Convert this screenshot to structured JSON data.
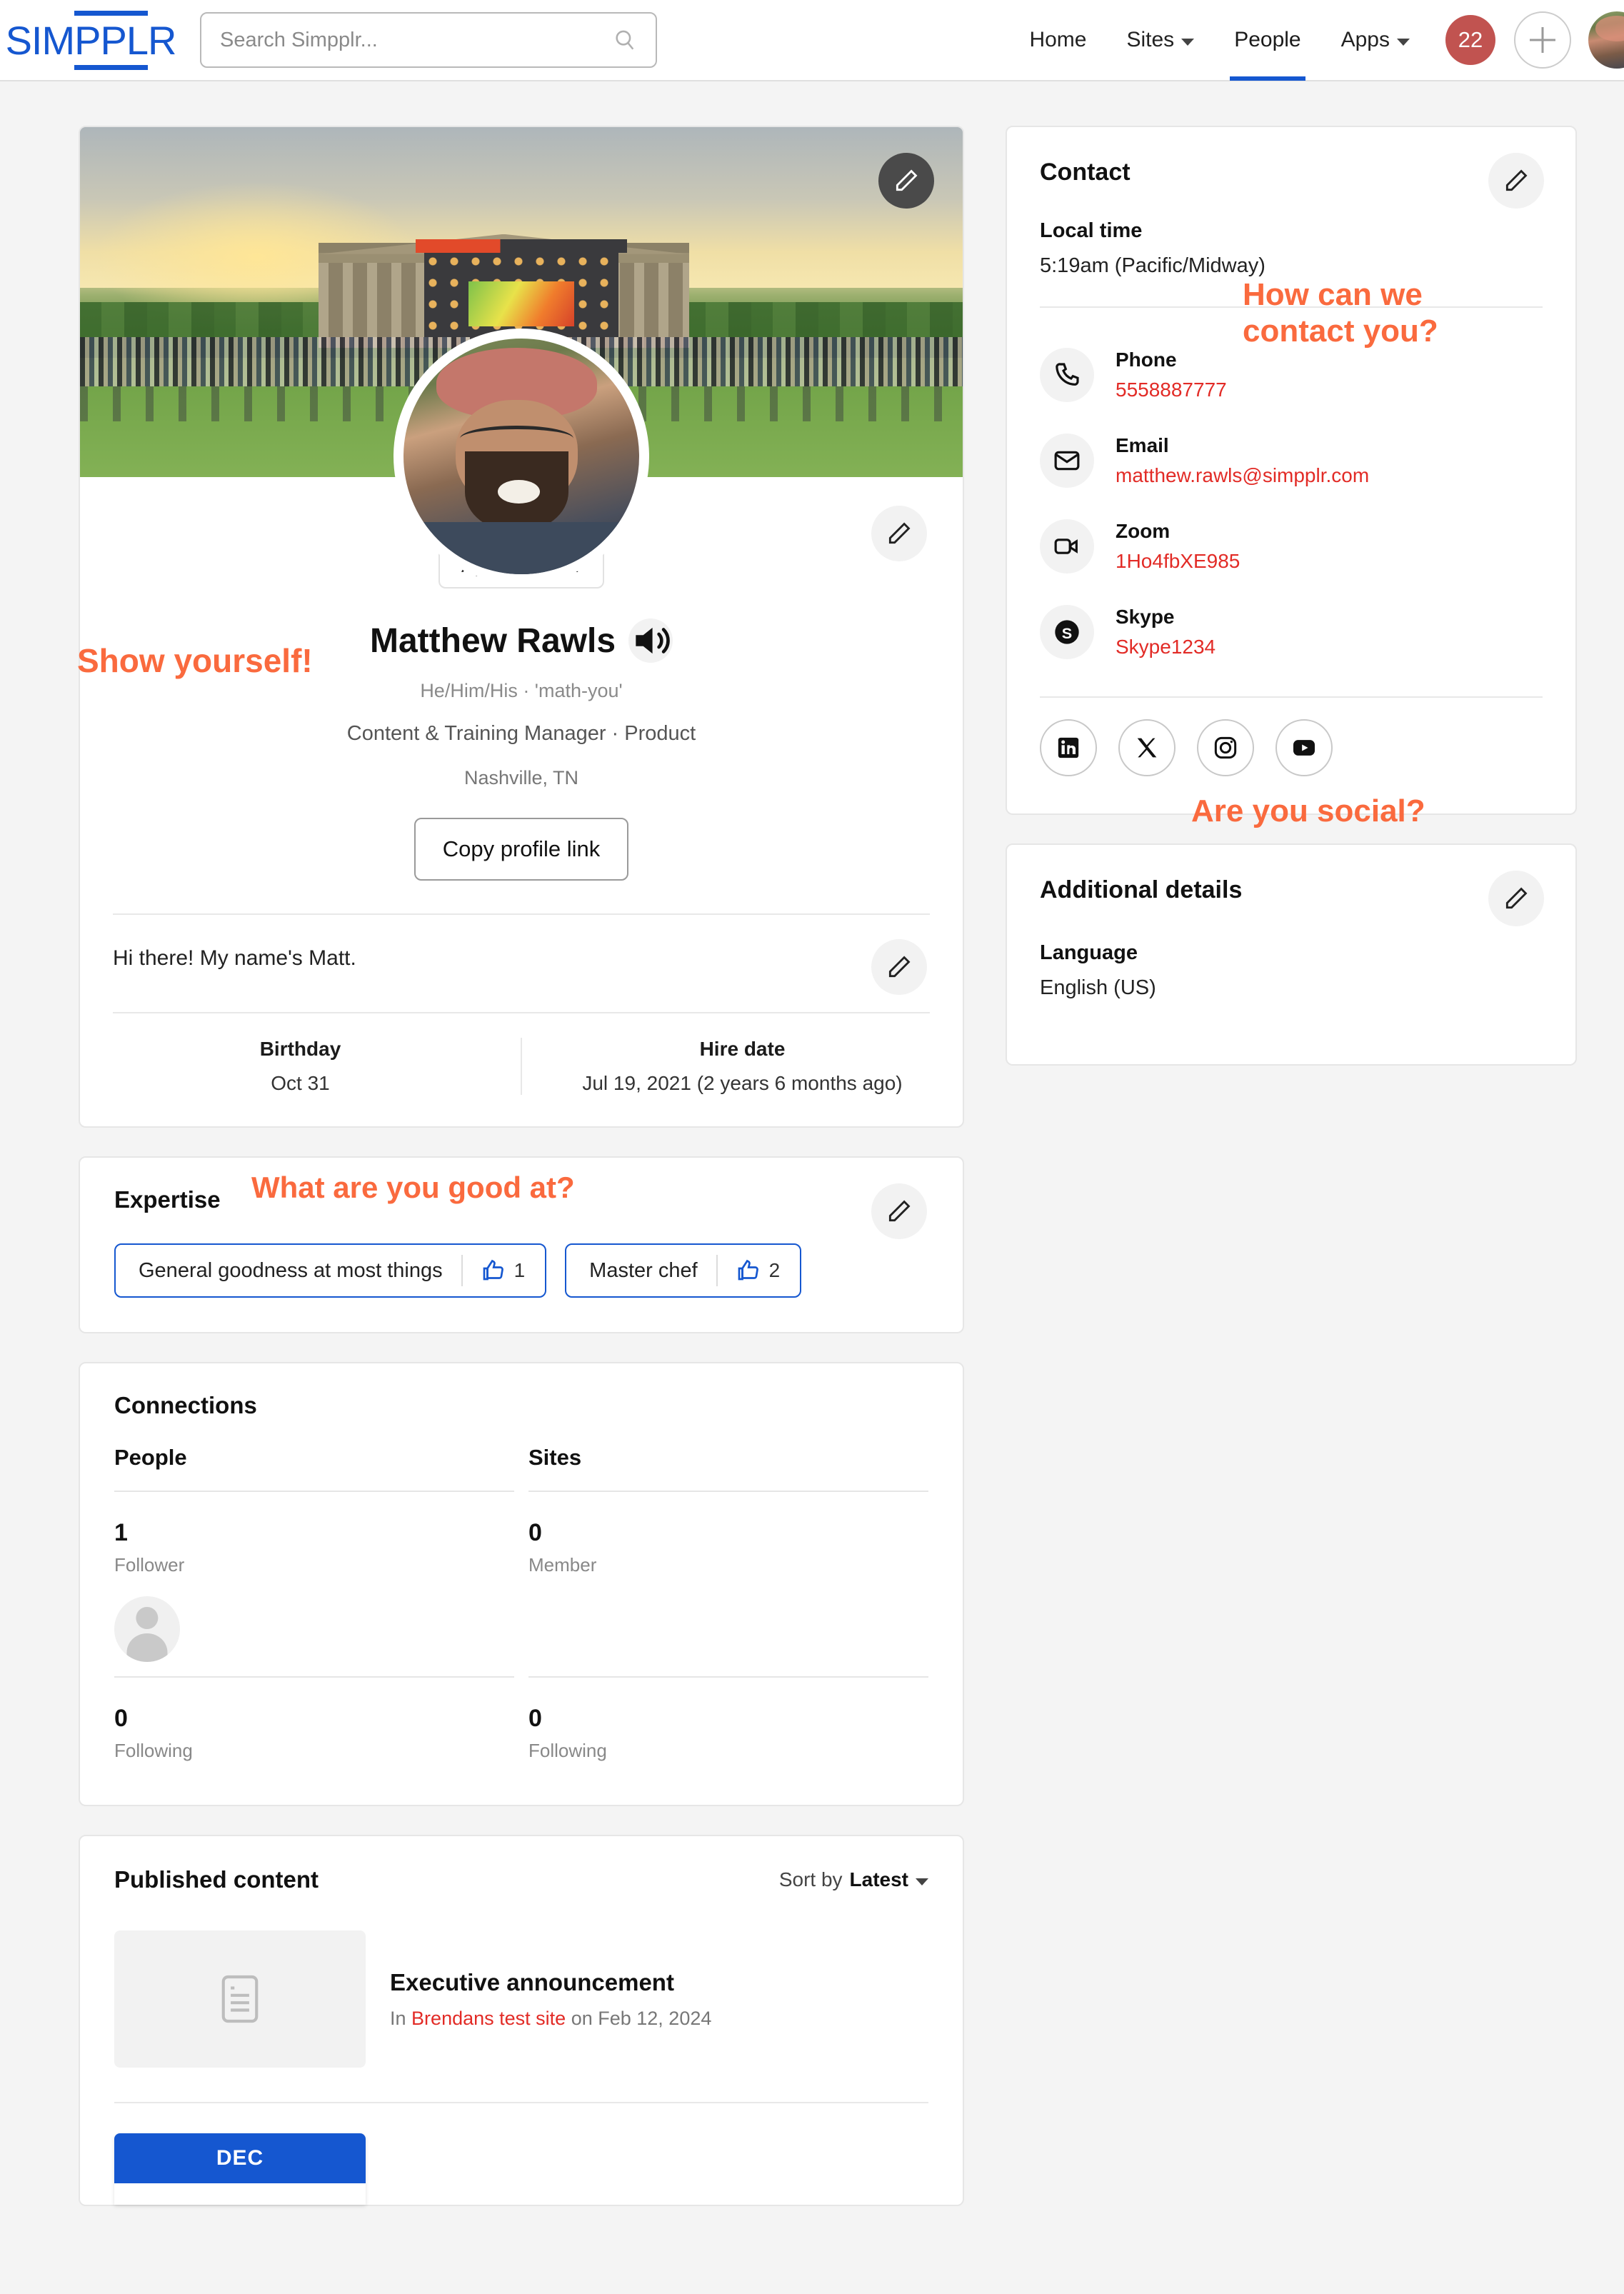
{
  "brand": {
    "logo_prefix": "SIM",
    "logo_boxed": "PPL",
    "logo_suffix": "R",
    "accent": "#1557d0",
    "annotation_color": "#fa6a3e",
    "link_red": "#e22b26"
  },
  "search": {
    "placeholder": "Search Simpplr...",
    "value": ""
  },
  "nav": {
    "items": [
      {
        "label": "Home",
        "has_caret": false,
        "active": false
      },
      {
        "label": "Sites",
        "has_caret": true,
        "active": false
      },
      {
        "label": "People",
        "has_caret": false,
        "active": true
      },
      {
        "label": "Apps",
        "has_caret": true,
        "active": false
      }
    ],
    "notification_count": "22"
  },
  "annotations": [
    {
      "id": "show-yourself",
      "text": "Show yourself!"
    },
    {
      "id": "how-contact",
      "line1": "How can we",
      "line2": "contact you?"
    },
    {
      "id": "good-at",
      "text": "What are you good at?"
    },
    {
      "id": "social",
      "text": "Are you social?"
    }
  ],
  "profile": {
    "role_pill": "App manager",
    "name": "Matthew Rawls",
    "pronouns_phonetic": "He/Him/His · 'math-you'",
    "title_department": "Content & Training Manager · Product",
    "location": "Nashville,  TN",
    "copy_link_label": "Copy profile link",
    "bio": "Hi there! My name's Matt.",
    "facts": [
      {
        "label": "Birthday",
        "value": "Oct 31"
      },
      {
        "label": "Hire date",
        "value": "Jul 19, 2021 (2 years 6 months ago)"
      }
    ]
  },
  "expertise": {
    "title": "Expertise",
    "items": [
      {
        "label": "General goodness at most things",
        "endorsements": "1"
      },
      {
        "label": "Master chef",
        "endorsements": "2"
      }
    ]
  },
  "connections": {
    "title": "Connections",
    "columns": [
      {
        "heading": "People",
        "stats": [
          {
            "count": "1",
            "label": "Follower",
            "has_avatars": true
          },
          {
            "count": "0",
            "label": "Following",
            "has_avatars": false
          }
        ]
      },
      {
        "heading": "Sites",
        "stats": [
          {
            "count": "0",
            "label": "Member",
            "has_avatars": false
          },
          {
            "count": "0",
            "label": "Following",
            "has_avatars": false
          }
        ]
      }
    ]
  },
  "published": {
    "title": "Published content",
    "sort_prefix": "Sort by",
    "sort_value": "Latest",
    "items": [
      {
        "title": "Executive announcement",
        "meta_prefix": "In",
        "site": "Brendans test site",
        "meta_mid": "on",
        "date": "Feb 12, 2024"
      }
    ],
    "next_tile_month": "DEC"
  },
  "contact": {
    "title": "Contact",
    "local_time_label": "Local time",
    "local_time_value": "5:19am (Pacific/Midway)",
    "rows": [
      {
        "icon": "phone-icon",
        "label": "Phone",
        "value": "5558887777"
      },
      {
        "icon": "email-icon",
        "label": "Email",
        "value": "matthew.rawls@simpplr.com"
      },
      {
        "icon": "zoom-icon",
        "label": "Zoom",
        "value": "1Ho4fbXE985"
      },
      {
        "icon": "skype-icon",
        "label": "Skype",
        "value": "Skype1234"
      }
    ],
    "socials": [
      "linkedin-icon",
      "x-twitter-icon",
      "instagram-icon",
      "youtube-icon"
    ]
  },
  "additional": {
    "title": "Additional details",
    "language_label": "Language",
    "language_value": "English (US)"
  }
}
